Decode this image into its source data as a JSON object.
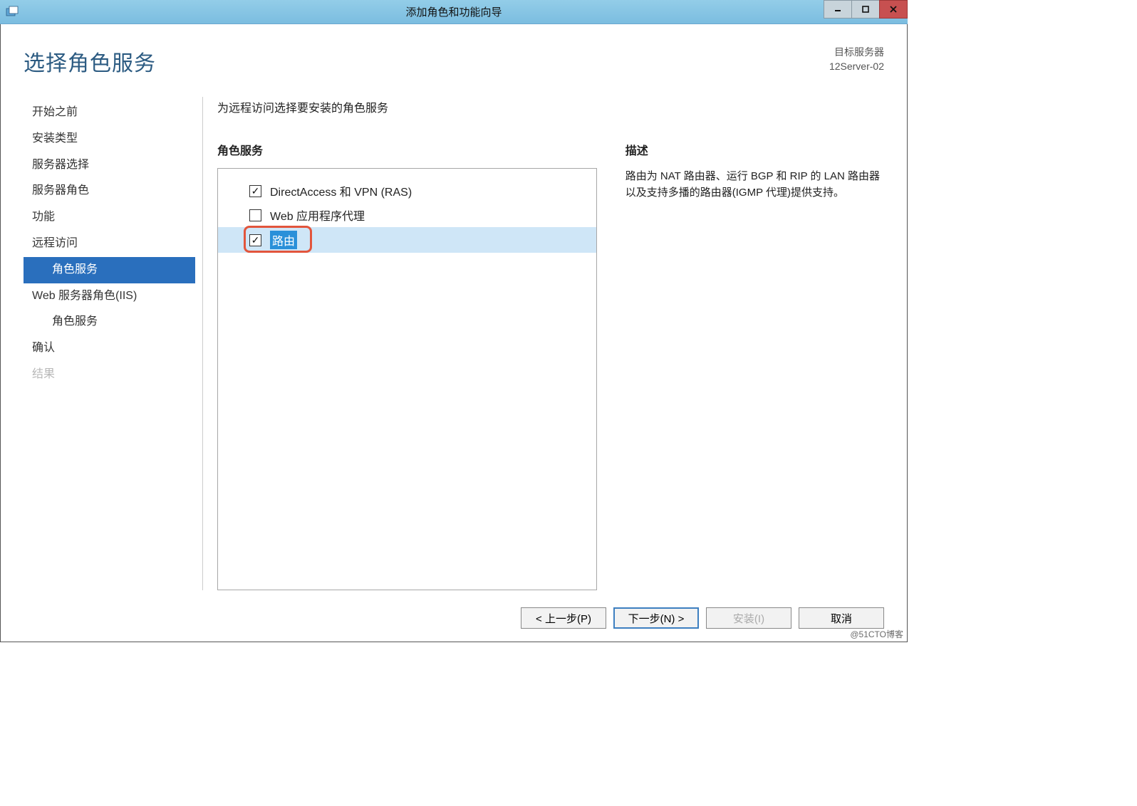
{
  "window": {
    "title": "添加角色和功能向导"
  },
  "header": {
    "page_title": "选择角色服务",
    "target_label": "目标服务器",
    "target_name": "12Server-02"
  },
  "nav": {
    "items": [
      {
        "label": "开始之前",
        "indent": false,
        "active": false,
        "disabled": false
      },
      {
        "label": "安装类型",
        "indent": false,
        "active": false,
        "disabled": false
      },
      {
        "label": "服务器选择",
        "indent": false,
        "active": false,
        "disabled": false
      },
      {
        "label": "服务器角色",
        "indent": false,
        "active": false,
        "disabled": false
      },
      {
        "label": "功能",
        "indent": false,
        "active": false,
        "disabled": false
      },
      {
        "label": "远程访问",
        "indent": false,
        "active": false,
        "disabled": false
      },
      {
        "label": "角色服务",
        "indent": true,
        "active": true,
        "disabled": false
      },
      {
        "label": "Web 服务器角色(IIS)",
        "indent": false,
        "active": false,
        "disabled": false
      },
      {
        "label": "角色服务",
        "indent": true,
        "active": false,
        "disabled": false
      },
      {
        "label": "确认",
        "indent": false,
        "active": false,
        "disabled": false
      },
      {
        "label": "结果",
        "indent": false,
        "active": false,
        "disabled": true
      }
    ]
  },
  "main": {
    "instruction": "为远程访问选择要安装的角色服务",
    "roles_label": "角色服务",
    "roles": [
      {
        "label": "DirectAccess 和 VPN (RAS)",
        "checked": true,
        "selected": false,
        "highlight": false
      },
      {
        "label": "Web 应用程序代理",
        "checked": false,
        "selected": false,
        "highlight": false
      },
      {
        "label": "路由",
        "checked": true,
        "selected": true,
        "highlight": true
      }
    ],
    "desc_label": "描述",
    "desc_text": "路由为 NAT 路由器、运行 BGP 和 RIP 的 LAN 路由器以及支持多播的路由器(IGMP 代理)提供支持。"
  },
  "footer": {
    "prev": "< 上一步(P)",
    "next": "下一步(N) >",
    "install": "安装(I)",
    "cancel": "取消"
  },
  "watermark": "@51CTO博客"
}
